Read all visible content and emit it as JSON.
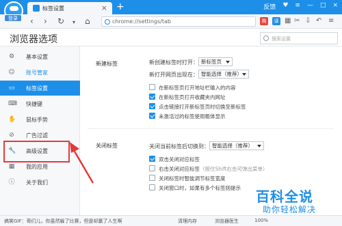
{
  "window": {
    "login_badge": "登录",
    "tab_title": "标签设置",
    "tab_close": "×",
    "new_tab": "+",
    "feedback": "反馈",
    "controls": [
      "♥",
      "≡",
      "—",
      "□",
      "×"
    ]
  },
  "nav": {
    "back": "‹",
    "forward": "›",
    "refresh": "↻",
    "home": "⌂",
    "url": "chrome://settings/tab",
    "ext1": "购",
    "ext2": "译",
    "accent": "#1e8fe8"
  },
  "header": {
    "title": "浏览器选项",
    "search_placeholder": "搜索设置"
  },
  "sidebar": {
    "items": [
      {
        "icon": "⚙",
        "label": "基本设置"
      },
      {
        "icon": "☺",
        "label": "账号管家"
      },
      {
        "icon": "▭",
        "label": "标签设置"
      },
      {
        "icon": "⌨",
        "label": "快捷键"
      },
      {
        "icon": "✋",
        "label": "鼠标手势"
      },
      {
        "icon": "⊘",
        "label": "广告过滤"
      },
      {
        "icon": "🔧",
        "label": "高级设置"
      },
      {
        "icon": "▦",
        "label": "我的应用"
      },
      {
        "icon": "ⓘ",
        "label": "关于我们"
      }
    ]
  },
  "main": {
    "new_tab": {
      "heading": "新建标签",
      "open_new_label": "新创建标签时打开：",
      "open_new_value": "新标签页",
      "open_pos_label": "新打开网页出现在：",
      "open_pos_value": "智能选择（推荐）",
      "checks": [
        {
          "label": "在新标签页打开地址栏输入的内容",
          "checked": false
        },
        {
          "label": "在新标签页打开收藏夹内网址",
          "checked": true
        },
        {
          "label": "点击链接打开新标签页时切换至新标签",
          "checked": true
        },
        {
          "label": "未激活过的标签使用粗体显示",
          "checked": true
        }
      ]
    },
    "close_tab": {
      "heading": "关闭标签",
      "switch_label": "关闭当前标签后切换到：",
      "switch_value": "智能选择（推荐）",
      "checks": [
        {
          "label": "双击关闭对应标签",
          "checked": true
        },
        {
          "label": "右击关闭对应标签",
          "hint": "（按住Shift右击可弹出菜单）",
          "checked": false
        },
        {
          "label": "关闭标签时智能调节标签宽度",
          "checked": false
        },
        {
          "label": "关闭窗口时，如果有多个标签则提示",
          "checked": false
        }
      ]
    }
  },
  "watermark": {
    "line1": "百科全说",
    "line2": "助你轻松解决"
  },
  "status": {
    "gif": "搞笑GIF：哥们儿，你虽然躲了比赛，但是却赢了人生啊",
    "clean": "清理内存",
    "doctor": "浏览器医生",
    "zoom": "100%"
  }
}
